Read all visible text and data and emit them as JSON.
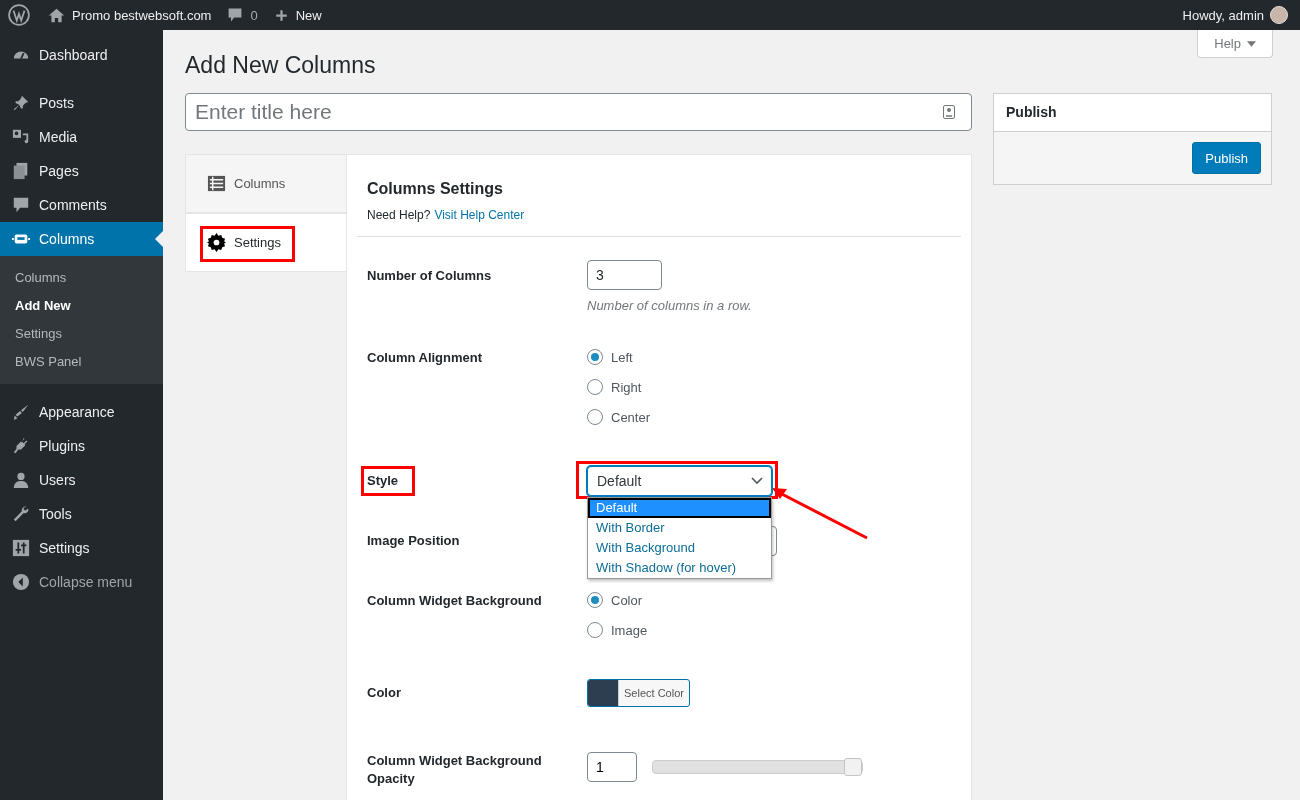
{
  "admin_bar": {
    "site_name": "Promo bestwebsoft.com",
    "comments_count": "0",
    "new_label": "New",
    "greeting": "Howdy, admin"
  },
  "sidebar": {
    "items": [
      {
        "label": "Dashboard",
        "selected": false
      },
      {
        "label": "Posts",
        "selected": false
      },
      {
        "label": "Media",
        "selected": false
      },
      {
        "label": "Pages",
        "selected": false
      },
      {
        "label": "Comments",
        "selected": false
      },
      {
        "label": "Columns",
        "selected": true,
        "submenu": [
          {
            "label": "Columns",
            "selected": false
          },
          {
            "label": "Add New",
            "selected": true
          },
          {
            "label": "Settings",
            "selected": false
          },
          {
            "label": "BWS Panel",
            "selected": false
          }
        ]
      },
      {
        "label": "Appearance",
        "selected": false
      },
      {
        "label": "Plugins",
        "selected": false
      },
      {
        "label": "Users",
        "selected": false
      },
      {
        "label": "Tools",
        "selected": false
      },
      {
        "label": "Settings",
        "selected": false
      }
    ],
    "collapse_label": "Collapse menu"
  },
  "help_tab": "Help",
  "page_title": "Add New Columns",
  "title_field": {
    "placeholder": "Enter title here"
  },
  "metabox": {
    "tabs": [
      {
        "label": "Columns",
        "selected": false,
        "highlighted": false
      },
      {
        "label": "Settings",
        "selected": true,
        "highlighted": true
      }
    ],
    "heading": "Columns Settings",
    "help_text": "Need Help?",
    "help_link": "Visit Help Center",
    "fields": [
      {
        "kind": "number",
        "label": "Number of Columns",
        "value": "3",
        "hint": "Number of columns in a row."
      },
      {
        "kind": "radio",
        "label": "Column Alignment",
        "options": [
          {
            "label": "Left",
            "selected": true
          },
          {
            "label": "Right",
            "selected": false
          },
          {
            "label": "Center",
            "selected": false
          }
        ]
      },
      {
        "kind": "select",
        "label": "Style",
        "value": "Default",
        "highlighted": true,
        "expanded": true,
        "options": [
          {
            "label": "Default",
            "selected": true
          },
          {
            "label": "With Border",
            "selected": false
          },
          {
            "label": "With Background",
            "selected": false
          },
          {
            "label": "With Shadow (for hover)",
            "selected": false
          }
        ]
      },
      {
        "kind": "select",
        "label": "Image Position",
        "highlighted": false,
        "expanded": false
      },
      {
        "kind": "radio",
        "label": "Column Widget Background",
        "options": [
          {
            "label": "Color",
            "selected": true
          },
          {
            "label": "Image",
            "selected": false
          }
        ]
      },
      {
        "kind": "color",
        "label": "Color",
        "color": "#2c3e50",
        "button_label": "Select Color"
      },
      {
        "kind": "slider",
        "label": "Column Widget Background Opacity",
        "value": "1",
        "level": 1
      }
    ]
  },
  "publish_box": {
    "title": "Publish",
    "button": "Publish"
  }
}
